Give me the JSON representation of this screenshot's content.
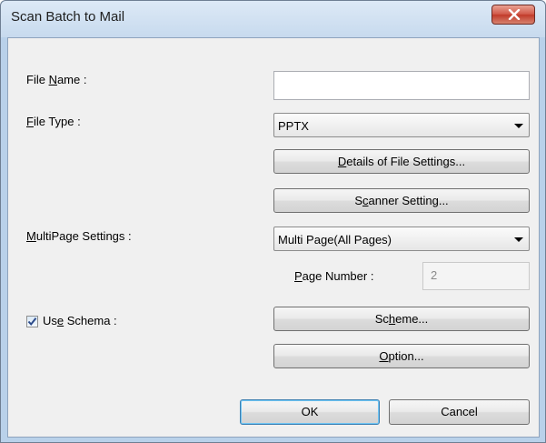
{
  "window": {
    "title": "Scan Batch to Mail"
  },
  "file_name": {
    "label_pre": "File ",
    "label_key": "N",
    "label_post": "ame :",
    "value": ""
  },
  "file_type": {
    "label_key": "F",
    "label_post": "ile Type :",
    "selected": "PPTX"
  },
  "buttons": {
    "details_pre": "",
    "details_key": "D",
    "details_post": "etails of File Settings...",
    "scanner_pre": "S",
    "scanner_key": "c",
    "scanner_post": "anner Setting...",
    "scheme_pre": "Sc",
    "scheme_key": "h",
    "scheme_post": "eme...",
    "option_key": "O",
    "option_post": "ption...",
    "ok": "OK",
    "cancel": "Cancel"
  },
  "multipage": {
    "label_key": "M",
    "label_post": "ultiPage Settings :",
    "selected": "Multi Page(All Pages)"
  },
  "page_number": {
    "label_key": "P",
    "label_post": "age Number :",
    "value": "2"
  },
  "use_schema": {
    "label_pre": "Us",
    "label_key": "e",
    "label_post": " Schema :",
    "checked": true
  },
  "icons": {
    "close": "close-icon",
    "check": "check-icon",
    "dropdown": "chevron-down-icon"
  }
}
